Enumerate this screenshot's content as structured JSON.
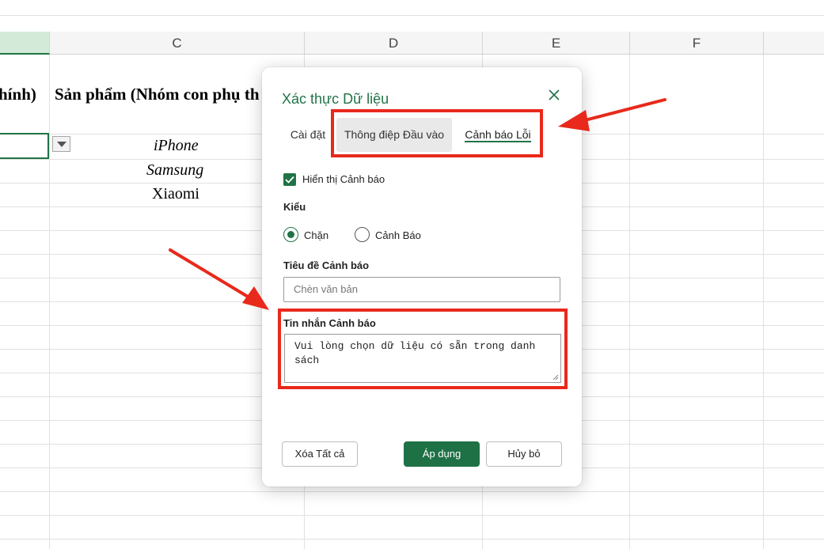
{
  "sheet": {
    "columns": [
      {
        "label": "",
        "active": true
      },
      {
        "label": "C"
      },
      {
        "label": "D"
      },
      {
        "label": "E"
      },
      {
        "label": "F"
      }
    ],
    "cells": {
      "b2_partial": "hính)",
      "c2": "Sản phẩm (Nhóm con phụ th",
      "c3": "iPhone",
      "c4": "Samsung",
      "c5": "Xiaomi"
    }
  },
  "dialog": {
    "title": "Xác thực Dữ liệu",
    "tabs": [
      {
        "label": "Cài đặt"
      },
      {
        "label": "Thông điệp Đầu vào"
      },
      {
        "label": "Cảnh báo Lỗi",
        "selected": true
      }
    ],
    "show_alert": {
      "label": "Hiển thị Cảnh báo",
      "checked": true
    },
    "style": {
      "label": "Kiểu",
      "options": [
        {
          "label": "Chặn",
          "selected": true
        },
        {
          "label": "Cảnh Báo",
          "selected": false
        }
      ]
    },
    "alert_title": {
      "label": "Tiêu đề Cảnh báo",
      "placeholder": "Chèn văn bản",
      "value": ""
    },
    "alert_message": {
      "label": "Tin nhắn Cảnh báo",
      "value": "Vui lòng chọn dữ liệu có sẵn trong danh sách"
    },
    "buttons": {
      "clear_all": "Xóa Tất cả",
      "apply": "Áp dụng",
      "cancel": "Hủy bỏ"
    }
  },
  "colors": {
    "accent": "#217346",
    "primary_button": "#1e7145",
    "annotation": "#e8291b"
  }
}
